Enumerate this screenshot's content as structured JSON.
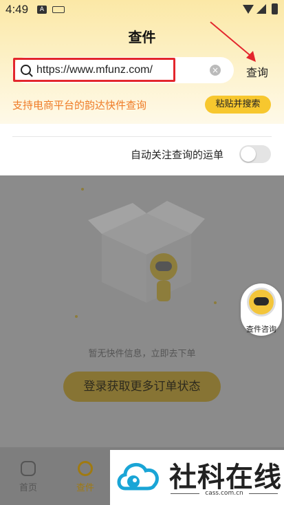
{
  "status_bar": {
    "time": "4:49",
    "icons": [
      "a-icon",
      "keyboard-icon",
      "wifi-icon",
      "signal-icon",
      "battery-icon"
    ]
  },
  "header": {
    "title": "查件"
  },
  "search": {
    "value": "https://www.mfunz.com/",
    "query_label": "查询"
  },
  "hint": {
    "text": "支持电商平台的韵达快件查询",
    "paste_button": "粘贴并搜索"
  },
  "follow": {
    "label": "自动关注查询的运单",
    "enabled": false
  },
  "empty_state": {
    "message": "暂无快件信息，立即去下单",
    "login_button": "登录获取更多订单状态"
  },
  "float_button": {
    "label": "查件咨询"
  },
  "tabbar": {
    "tabs": [
      {
        "label": "首页",
        "active": false
      },
      {
        "label": "查件",
        "active": true
      }
    ]
  },
  "watermark": {
    "brand": "社科在线",
    "domain": "cass.com.cn"
  },
  "colors": {
    "accent": "#f7c72e",
    "highlight": "#e3262d",
    "hint": "#ef7b26"
  }
}
